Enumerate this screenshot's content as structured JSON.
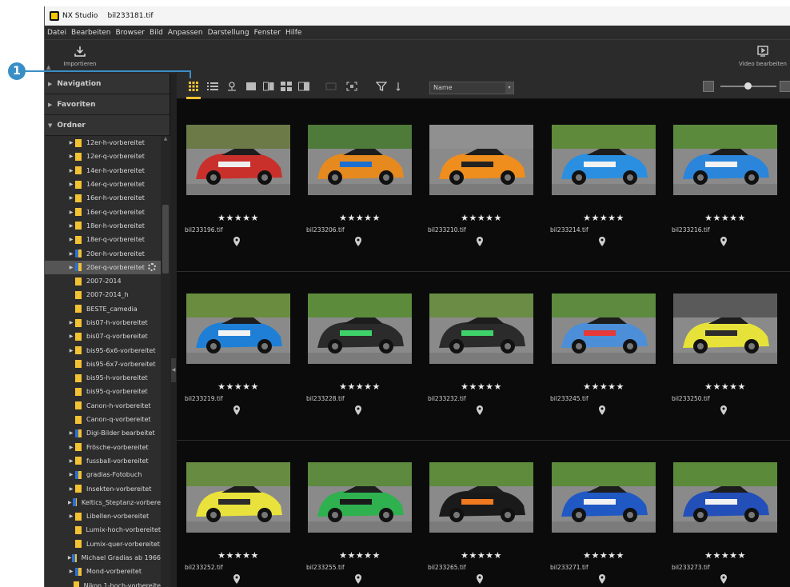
{
  "title_bar": {
    "app_name": "NX Studio",
    "filename": "bil233181.tif"
  },
  "menu": [
    "Datei",
    "Bearbeiten",
    "Browser",
    "Bild",
    "Anpassen",
    "Darstellung",
    "Fenster",
    "Hilfe"
  ],
  "toolbar": {
    "import_label": "Importieren",
    "video_label": "Video bearbeiten"
  },
  "callout": {
    "number": "1"
  },
  "sidebar": {
    "sections": [
      "Navigation",
      "Favoriten",
      "Ordner"
    ],
    "folders": [
      {
        "label": "12er-h-vorbereitet",
        "expandable": true,
        "icon": "y"
      },
      {
        "label": "12er-q-vorbereitet",
        "expandable": true,
        "icon": "y"
      },
      {
        "label": "14er-h-vorbereitet",
        "expandable": true,
        "icon": "y"
      },
      {
        "label": "14er-q-vorbereitet",
        "expandable": true,
        "icon": "y"
      },
      {
        "label": "16er-h-vorbereitet",
        "expandable": true,
        "icon": "y"
      },
      {
        "label": "16er-q-vorbereitet",
        "expandable": true,
        "icon": "y"
      },
      {
        "label": "18er-h-vorbereitet",
        "expandable": true,
        "icon": "y"
      },
      {
        "label": "18er-q-vorbereitet",
        "expandable": true,
        "icon": "y"
      },
      {
        "label": "20er-h-vorbereitet",
        "expandable": true,
        "icon": "b"
      },
      {
        "label": "20er-q-vorbereitet",
        "expandable": true,
        "icon": "b",
        "selected": true
      },
      {
        "label": "2007-2014",
        "expandable": false,
        "icon": "y"
      },
      {
        "label": "2007-2014_h",
        "expandable": false,
        "icon": "y"
      },
      {
        "label": "BESTE_camedia",
        "expandable": false,
        "icon": "y"
      },
      {
        "label": "bis07-h-vorbereitet",
        "expandable": true,
        "icon": "y"
      },
      {
        "label": "bis07-q-vorbereitet",
        "expandable": true,
        "icon": "y"
      },
      {
        "label": "bis95-6x6-vorbereitet",
        "expandable": true,
        "icon": "y"
      },
      {
        "label": "bis95-6x7-vorbereitet",
        "expandable": false,
        "icon": "y"
      },
      {
        "label": "bis95-h-vorbereitet",
        "expandable": false,
        "icon": "y"
      },
      {
        "label": "bis95-q-vorbereitet",
        "expandable": false,
        "icon": "y"
      },
      {
        "label": "Canon-h-vorbereitet",
        "expandable": false,
        "icon": "y"
      },
      {
        "label": "Canon-q-vorbereitet",
        "expandable": false,
        "icon": "y"
      },
      {
        "label": "Digi-Bilder bearbeitet",
        "expandable": true,
        "icon": "b"
      },
      {
        "label": "Frösche-vorbereitet",
        "expandable": true,
        "icon": "y"
      },
      {
        "label": "fussball-vorbereitet",
        "expandable": true,
        "icon": "y"
      },
      {
        "label": "gradias-Fotobuch",
        "expandable": true,
        "icon": "b"
      },
      {
        "label": "Insekten-vorbereitet",
        "expandable": true,
        "icon": "y"
      },
      {
        "label": "Keltics_Steptanz-vorbere",
        "expandable": true,
        "icon": "b"
      },
      {
        "label": "Libellen-vorbereitet",
        "expandable": true,
        "icon": "y"
      },
      {
        "label": "Lumix-hoch-vorbereitet",
        "expandable": false,
        "icon": "y"
      },
      {
        "label": "Lumix-quer-vorbereitet",
        "expandable": false,
        "icon": "y"
      },
      {
        "label": "Michael Gradias ab 1966",
        "expandable": true,
        "icon": "b"
      },
      {
        "label": "Mond-vorbereitet",
        "expandable": true,
        "icon": "b"
      },
      {
        "label": "Nikon 1-hoch-vorbereite",
        "expandable": false,
        "icon": "y"
      }
    ]
  },
  "browser_toolbar": {
    "sort_label": "Name"
  },
  "thumbnails": [
    {
      "filename": "bil233196.tif",
      "stars": "★★★★★",
      "car": "#c9302c",
      "accent": "#eeeeee",
      "bg": "#6b7a46"
    },
    {
      "filename": "bil233206.tif",
      "stars": "★★★★★",
      "car": "#e68a1f",
      "accent": "#1b6fd1",
      "bg": "#4e7a3a"
    },
    {
      "filename": "bil233210.tif",
      "stars": "★★★★★",
      "car": "#ef8d1d",
      "accent": "#222222",
      "bg": "#909090"
    },
    {
      "filename": "bil233214.tif",
      "stars": "★★★★★",
      "car": "#2a8fe0",
      "accent": "#f2f2f2",
      "bg": "#5f8a3b"
    },
    {
      "filename": "bil233216.tif",
      "stars": "★★★★★",
      "car": "#2a85db",
      "accent": "#f2f2f2",
      "bg": "#5c8a3d"
    },
    {
      "filename": "bil233219.tif",
      "stars": "★★★★★",
      "car": "#1f7fd6",
      "accent": "#f2f2f2",
      "bg": "#6a8c3e"
    },
    {
      "filename": "bil233228.tif",
      "stars": "★★★★★",
      "car": "#2b2b2b",
      "accent": "#3fd16a",
      "bg": "#5d8b3c"
    },
    {
      "filename": "bil233232.tif",
      "stars": "★★★★★",
      "car": "#2b2b2b",
      "accent": "#3fd16a",
      "bg": "#6b8c44"
    },
    {
      "filename": "bil233245.tif",
      "stars": "★★★★★",
      "car": "#4c8fd8",
      "accent": "#e63a3a",
      "bg": "#5d8a3e"
    },
    {
      "filename": "bil233250.tif",
      "stars": "★★★★★",
      "car": "#e7e23a",
      "accent": "#2b2b2b",
      "bg": "#5a5a5a"
    },
    {
      "filename": "bil233252.tif",
      "stars": "★★★★★",
      "car": "#e9e23c",
      "accent": "#2b2b2b",
      "bg": "#678b40"
    },
    {
      "filename": "bil233255.tif",
      "stars": "★★★★★",
      "car": "#2fb14f",
      "accent": "#1a1a1a",
      "bg": "#5d8a3e"
    },
    {
      "filename": "bil233265.tif",
      "stars": "★★★★★",
      "car": "#1a1a1a",
      "accent": "#f07a1f",
      "bg": "#5e8b3c"
    },
    {
      "filename": "bil233271.tif",
      "stars": "★★★★★",
      "car": "#2059c4",
      "accent": "#f2f2f2",
      "bg": "#5c8b3c"
    },
    {
      "filename": "bil233273.tif",
      "stars": "★★★★★",
      "car": "#234fb8",
      "accent": "#f2f2f2",
      "bg": "#5a8a3a"
    }
  ]
}
